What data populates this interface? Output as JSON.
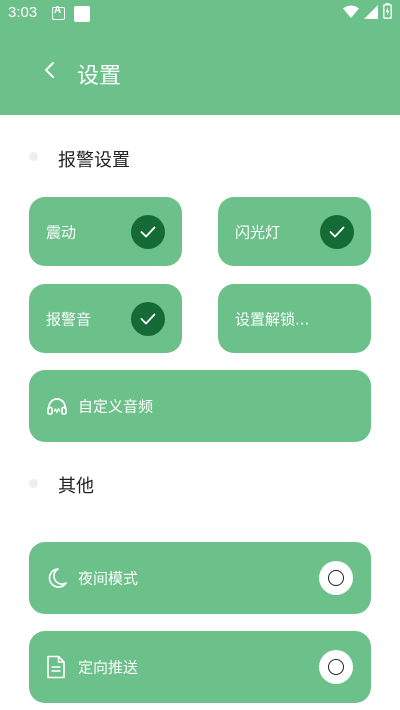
{
  "status_bar": {
    "time": "3:03"
  },
  "header": {
    "title": "设置",
    "back_icon": "chevron-left-icon"
  },
  "sections": {
    "alarm": {
      "title": "报警设置",
      "items": [
        {
          "label": "震动",
          "checked": true
        },
        {
          "label": "闪光灯",
          "checked": true
        },
        {
          "label": "报警音",
          "checked": true
        },
        {
          "label": "设置解锁..."
        }
      ],
      "custom_audio": {
        "label": "自定义音频",
        "icon": "headphones-icon"
      }
    },
    "other": {
      "title": "其他",
      "items": [
        {
          "label": "夜间模式",
          "icon": "moon-icon",
          "selected": false
        },
        {
          "label": "定向推送",
          "icon": "document-icon",
          "selected": false
        }
      ]
    }
  },
  "colors": {
    "accent": "#6cc08a",
    "check_dark": "#146b35",
    "section_dot": "#e7f3ea"
  }
}
